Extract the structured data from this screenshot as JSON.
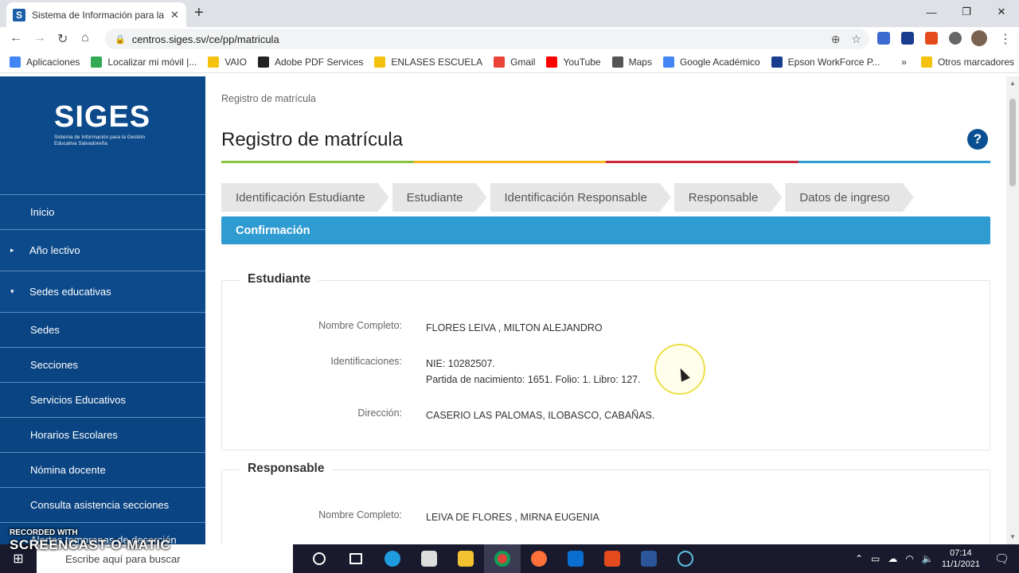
{
  "browser": {
    "tab_title": "Sistema de Información para la G",
    "tab_favicon": "S",
    "url": "centros.siges.sv/ce/pp/matricula",
    "bookmarks": [
      {
        "label": "Aplicaciones",
        "color": "#4285f4"
      },
      {
        "label": "Localizar mi móvil |...",
        "color": "#34a853"
      },
      {
        "label": "VAIO",
        "color": "#f4c20d"
      },
      {
        "label": "Adobe PDF Services",
        "color": "#222222"
      },
      {
        "label": "ENLASES ESCUELA",
        "color": "#f4c20d"
      },
      {
        "label": "Gmail",
        "color": "#ea4335"
      },
      {
        "label": "YouTube",
        "color": "#ff0000"
      },
      {
        "label": "Maps",
        "color": "#555555"
      },
      {
        "label": "Google Académico",
        "color": "#4285f4"
      },
      {
        "label": "Epson WorkForce P...",
        "color": "#1a3c8f"
      }
    ],
    "bookmarks_more": "»",
    "other_bookmarks": "Otros marcadores"
  },
  "app": {
    "logo_title": "SIGES",
    "logo_subtitle": "Sistema de Información para la Gestión Educativa Salvadoreña",
    "menu": [
      {
        "label": "Inicio",
        "type": "item"
      },
      {
        "label": "Año lectivo",
        "type": "group",
        "arrow": "▸"
      },
      {
        "label": "Sedes educativas",
        "type": "group",
        "arrow": "▾"
      },
      {
        "label": "Sedes",
        "type": "sub"
      },
      {
        "label": "Secciones",
        "type": "sub"
      },
      {
        "label": "Servicios Educativos",
        "type": "sub"
      },
      {
        "label": "Horarios Escolares",
        "type": "sub"
      },
      {
        "label": "Nómina docente",
        "type": "sub"
      },
      {
        "label": "Consulta asistencia secciones",
        "type": "sub"
      },
      {
        "label": "Alertas tempranas de deserción",
        "type": "sub"
      }
    ]
  },
  "page": {
    "breadcrumb": "Registro de matrícula",
    "title": "Registro de matrícula",
    "help": "?",
    "rule_colors": [
      "#8ac43f",
      "#f3b81d",
      "#c9283e",
      "#2e9bd1"
    ],
    "steps": [
      "Identificación Estudiante",
      "Estudiante",
      "Identificación Responsable",
      "Responsable",
      "Datos de ingreso"
    ],
    "active_step": "Confirmación",
    "student": {
      "legend": "Estudiante",
      "name_label": "Nombre Completo:",
      "name_value": "FLORES LEIVA , MILTON ALEJANDRO",
      "ids_label": "Identificaciones:",
      "ids_line1": "NIE: 10282507.",
      "ids_line2": "Partida de nacimiento: 1651. Folio: 1. Libro: 127.",
      "address_label": "Dirección:",
      "address_value": "CASERIO LAS PALOMAS, ILOBASCO, CABAÑAS."
    },
    "responsible": {
      "legend": "Responsable",
      "name_label": "Nombre Completo:",
      "name_value": "LEIVA DE FLORES , MIRNA EUGENIA"
    }
  },
  "taskbar": {
    "search_placeholder": "Escribe aquí para buscar",
    "time": "07:14",
    "date": "11/1/2021",
    "watermark_top": "RECORDED WITH",
    "watermark_main": "SCREENCAST-O-MATIC"
  }
}
